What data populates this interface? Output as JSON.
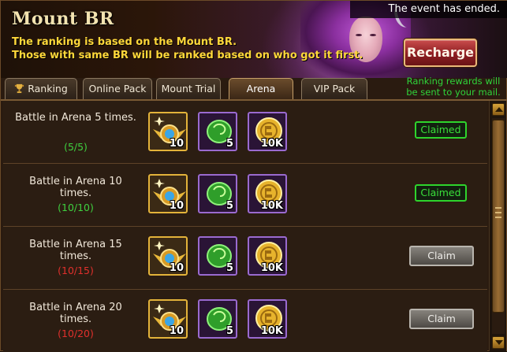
{
  "header": {
    "title": "Mount BR",
    "event_status": "The event has ended.",
    "desc_line1": "The ranking is based on the Mount BR.",
    "desc_line2": "Those with same BR will be ranked based on who got it first.",
    "recharge_label": "Recharge",
    "mail_note_line1": "Ranking rewards will",
    "mail_note_line2": "be sent to your mail."
  },
  "tabs": [
    {
      "label": "Ranking",
      "active": false,
      "icon": "trophy-icon"
    },
    {
      "label": "Online Pack",
      "active": false
    },
    {
      "label": "Mount Trial",
      "active": false
    },
    {
      "label": "Arena",
      "active": true
    },
    {
      "label": "VIP Pack",
      "active": false
    }
  ],
  "rows": [
    {
      "task_line1": "Battle in Arena 5 times.",
      "task_line2": "",
      "progress": "(5/5)",
      "complete": true,
      "rewards": [
        {
          "icon": "winged-medal-icon",
          "qty": "10"
        },
        {
          "icon": "green-gem-icon",
          "qty": "5"
        },
        {
          "icon": "gold-coin-icon",
          "qty": "10K"
        }
      ],
      "status": "Claimed"
    },
    {
      "task_line1": "Battle in Arena 10",
      "task_line2": "times.",
      "progress": "(10/10)",
      "complete": true,
      "rewards": [
        {
          "icon": "winged-medal-icon",
          "qty": "10"
        },
        {
          "icon": "green-gem-icon",
          "qty": "5"
        },
        {
          "icon": "gold-coin-icon",
          "qty": "10K"
        }
      ],
      "status": "Claimed"
    },
    {
      "task_line1": "Battle in Arena 15",
      "task_line2": "times.",
      "progress": "(10/15)",
      "complete": false,
      "rewards": [
        {
          "icon": "winged-medal-icon",
          "qty": "10"
        },
        {
          "icon": "green-gem-icon",
          "qty": "5"
        },
        {
          "icon": "gold-coin-icon",
          "qty": "10K"
        }
      ],
      "status": "Claim"
    },
    {
      "task_line1": "Battle in Arena 20",
      "task_line2": "times.",
      "progress": "(10/20)",
      "complete": false,
      "rewards": [
        {
          "icon": "winged-medal-icon",
          "qty": "10"
        },
        {
          "icon": "green-gem-icon",
          "qty": "5"
        },
        {
          "icon": "gold-coin-icon",
          "qty": "10K"
        }
      ],
      "status": "Claim"
    }
  ],
  "colors": {
    "complete": "#3fd03f",
    "incomplete": "#e0302c",
    "highlight": "#ffd83a"
  }
}
